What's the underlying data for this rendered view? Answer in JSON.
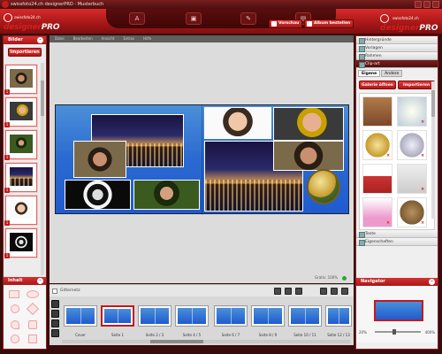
{
  "window": {
    "title": "swissfoto24.ch designerPRO - Musterbuch"
  },
  "brand": {
    "site": "swissfoto24.ch",
    "name_part1": "designer",
    "name_part2": "PRO"
  },
  "toolbar": {
    "icons": [
      "text-icon",
      "photo-icon",
      "edit-icon",
      "layout-icon"
    ],
    "preview_label": "Vorschau",
    "order_label": "Album bestellen"
  },
  "left_panel": {
    "header": "Bilder",
    "import_label": "Importieren",
    "thumb_numbers": [
      "1",
      "1",
      "1",
      "1",
      "1",
      "1"
    ],
    "inhalt_header": "Inhalt"
  },
  "main_menu": [
    "Datei",
    "Bearbeiten",
    "Ansicht",
    "Extras",
    "Hilfe"
  ],
  "canvas": {
    "gratis_text": "Gratis: 100%",
    "grid_label": "Gitternetz"
  },
  "pages": [
    {
      "label": "Cover"
    },
    {
      "label": "Seite 1"
    },
    {
      "label": "Seite 2 / 3"
    },
    {
      "label": "Seite 4 / 5"
    },
    {
      "label": "Seite 6 / 7"
    },
    {
      "label": "Seite 8 / 9"
    },
    {
      "label": "Seite 10 / 11"
    },
    {
      "label": "Seite 12 / 13"
    }
  ],
  "right_panel": {
    "sections": [
      "Hintergründe",
      "Vorlagen",
      "Rahmen",
      "Clip-art"
    ],
    "tabs": [
      "Eigene",
      "Andere"
    ],
    "open_gallery_label": "Galerie öffnen",
    "import_label": "Importieren",
    "bottom_sections": [
      "Texte",
      "Eigenschaften"
    ],
    "navigator_header": "Navigator",
    "zoom_min": "20%",
    "zoom_max": "400%"
  },
  "colors": {
    "accent": "#c41a1a",
    "album_blue": "#2a6ad0"
  }
}
